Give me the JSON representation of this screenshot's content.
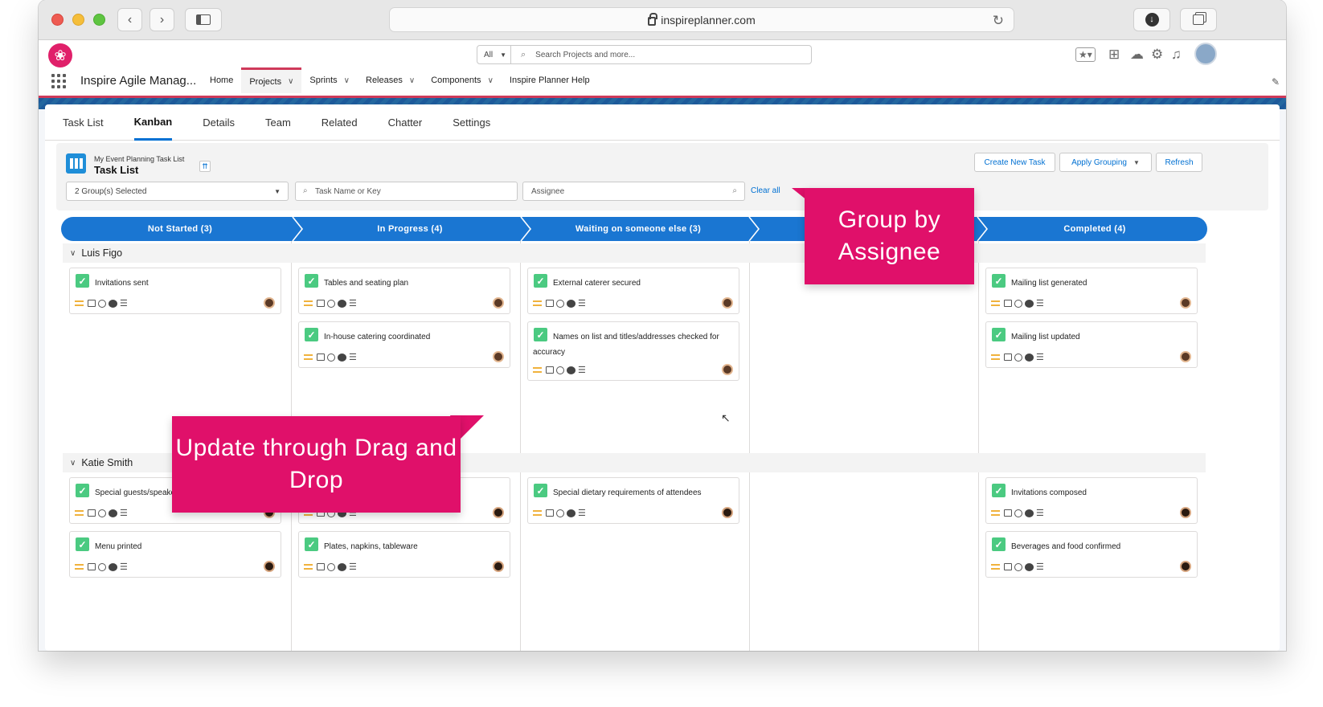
{
  "browser": {
    "url": "inspireplanner.com",
    "back_icon": "chevron-left-icon",
    "forward_icon": "chevron-right-icon"
  },
  "header": {
    "search_scope": "All",
    "search_placeholder": "Search Projects and more...",
    "app_name": "Inspire Agile Manag...",
    "nav": [
      {
        "label": "Home",
        "dropdown": false
      },
      {
        "label": "Projects",
        "dropdown": true,
        "active": true
      },
      {
        "label": "Sprints",
        "dropdown": true
      },
      {
        "label": "Releases",
        "dropdown": true
      },
      {
        "label": "Components",
        "dropdown": true
      },
      {
        "label": "Inspire Planner Help",
        "dropdown": false
      }
    ]
  },
  "tabs": [
    "Task List",
    "Kanban",
    "Details",
    "Team",
    "Related",
    "Chatter",
    "Settings"
  ],
  "active_tab": "Kanban",
  "task_list": {
    "subtitle": "My Event Planning Task List",
    "title": "Task List",
    "create_button": "Create New Task",
    "grouping_button": "Apply Grouping",
    "refresh_button": "Refresh",
    "group_filter": "2 Group(s) Selected",
    "task_search_placeholder": "Task Name or Key",
    "assignee_placeholder": "Assignee",
    "clear_all": "Clear all"
  },
  "stages": [
    {
      "label": "Not Started  (3)"
    },
    {
      "label": "In Progress  (4)"
    },
    {
      "label": "Waiting on someone else  (3)"
    },
    {
      "label": ""
    },
    {
      "label": "Completed  (4)"
    }
  ],
  "groups": [
    {
      "name": "Luis Figo",
      "columns": [
        [
          "Invitations sent"
        ],
        [
          "Tables and seating plan",
          "In-house catering coordinated"
        ],
        [
          "External caterer secured",
          "Names on list and titles/addresses checked for accuracy"
        ],
        [],
        [
          "Mailing list generated",
          "Mailing list updated"
        ]
      ]
    },
    {
      "name": "Katie Smith",
      "columns": [
        [
          "Special guests/speakers",
          "Menu printed"
        ],
        [
          "",
          "Plates, napkins, tableware"
        ],
        [
          "Special dietary requirements of attendees"
        ],
        [],
        [
          "Invitations composed",
          "Beverages and food confirmed"
        ]
      ]
    }
  ],
  "callouts": {
    "group_by": "Group by Assignee",
    "drag_drop": "Update through Drag and Drop"
  },
  "colors": {
    "accent": "#e0106a",
    "stage_bar": "#1a76d2",
    "checkbox": "#4bca81",
    "link": "#0070d2"
  }
}
